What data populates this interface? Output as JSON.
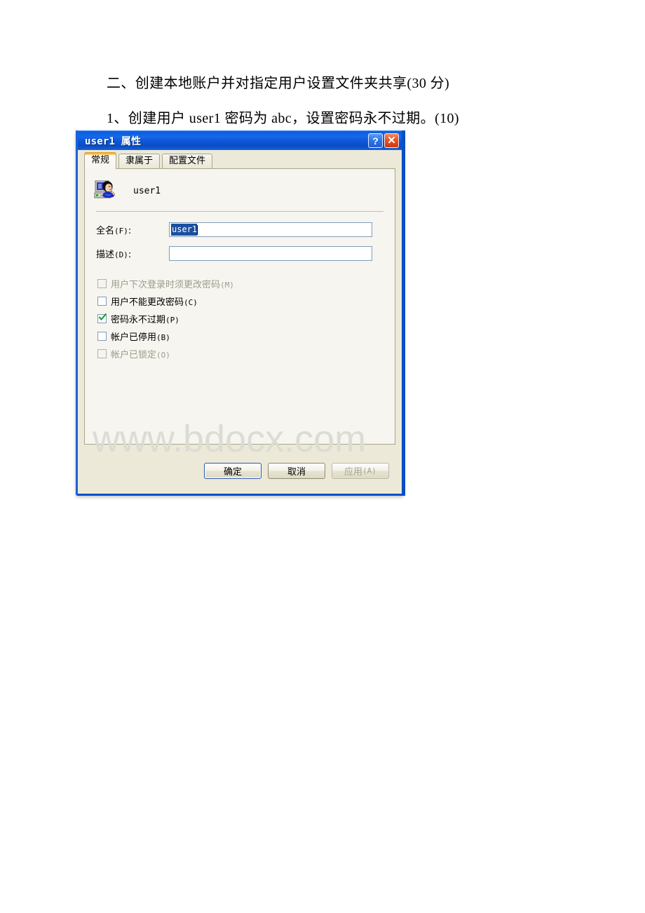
{
  "document": {
    "line1": "二、创建本地账户并对指定用户设置文件夹共享(30 分)",
    "line2": "1、创建用户 user1 密码为 abc，设置密码永不过期。(10)"
  },
  "dialog": {
    "title": "user1 属性",
    "titlebar_buttons": {
      "help": "?",
      "close": "✕"
    },
    "tabs": [
      {
        "label": "常规",
        "active": true
      },
      {
        "label": "隶属于",
        "active": false
      },
      {
        "label": "配置文件",
        "active": false
      }
    ],
    "identity": {
      "icon": "local-user-icon",
      "name": "user1"
    },
    "fields": [
      {
        "label": "全名",
        "mnemonic": "(F)",
        "suffix": ":",
        "value": "user1",
        "selected": true,
        "placeholder": ""
      },
      {
        "label": "描述",
        "mnemonic": "(D)",
        "suffix": ":",
        "value": "",
        "selected": false,
        "placeholder": ""
      }
    ],
    "checkboxes": [
      {
        "label": "用户下次登录时须更改密码",
        "mnemonic": "(M)",
        "checked": false,
        "disabled": true
      },
      {
        "label": "用户不能更改密码",
        "mnemonic": "(C)",
        "checked": false,
        "disabled": false
      },
      {
        "label": "密码永不过期",
        "mnemonic": "(P)",
        "checked": true,
        "disabled": false
      },
      {
        "label": "帐户已停用",
        "mnemonic": "(B)",
        "checked": false,
        "disabled": false
      },
      {
        "label": "帐户已锁定",
        "mnemonic": "(O)",
        "checked": false,
        "disabled": true
      }
    ],
    "buttons": [
      {
        "label": "确定",
        "mnemonic": "",
        "default": true,
        "disabled": false
      },
      {
        "label": "取消",
        "mnemonic": "",
        "default": false,
        "disabled": false
      },
      {
        "label": "应用",
        "mnemonic": "(A)",
        "default": false,
        "disabled": true
      }
    ]
  },
  "watermark": {
    "text": "www.bdocx.com"
  },
  "colors": {
    "titlebar_blue": "#0d5fe0",
    "window_face": "#ece9d8",
    "panel_face": "#f6f5f0",
    "active_tab_accent": "#fbb034",
    "selection_blue": "#1d4f9e",
    "check_green": "#1e9c32",
    "close_red": "#e6562a",
    "watermark_gray": "#dcdcd4",
    "border_blue": "#0a4fc9"
  }
}
